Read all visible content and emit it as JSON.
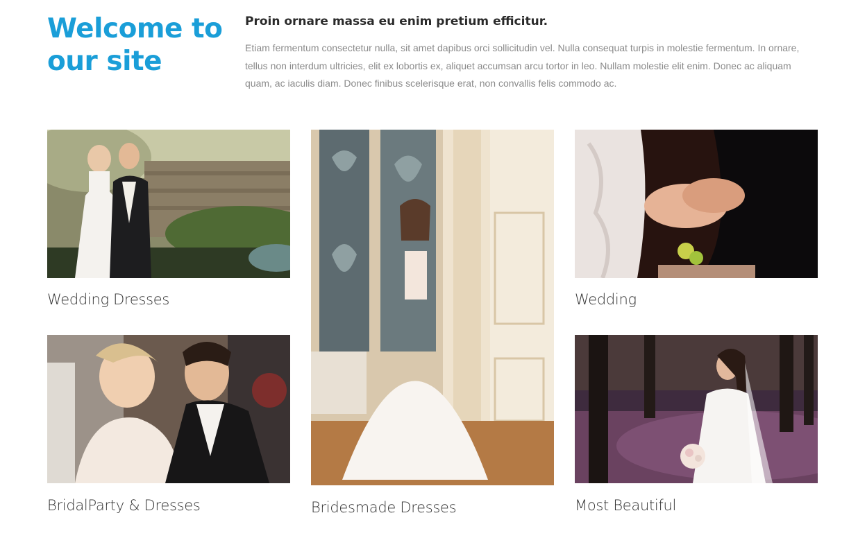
{
  "intro": {
    "title": "Welcome to our site",
    "heading": "Proin ornare massa eu enim pretium efficitur.",
    "body": "Etiam fermentum consectetur nulla, sit amet dapibus orci sollicitudin vel. Nulla consequat turpis in molestie fermentum. In ornare, tellus non interdum ultricies, elit ex lobortis ex, aliquet accumsan arcu tortor in leo. Nullam molestie elit enim. Donec ac aliquam quam, ac iaculis diam. Donec finibus scelerisque erat, non convallis felis commodo ac."
  },
  "gallery": {
    "items": [
      {
        "caption": "Wedding Dresses"
      },
      {
        "caption": "Bridesmade Dresses"
      },
      {
        "caption": "Wedding"
      },
      {
        "caption": "BridalParty & Dresses"
      },
      {
        "caption": "Most Beautiful"
      }
    ]
  },
  "colors": {
    "accent": "#1a9ed8",
    "heading": "#2a2a2a",
    "body_text": "#8a8a8a",
    "caption": "#333333"
  }
}
